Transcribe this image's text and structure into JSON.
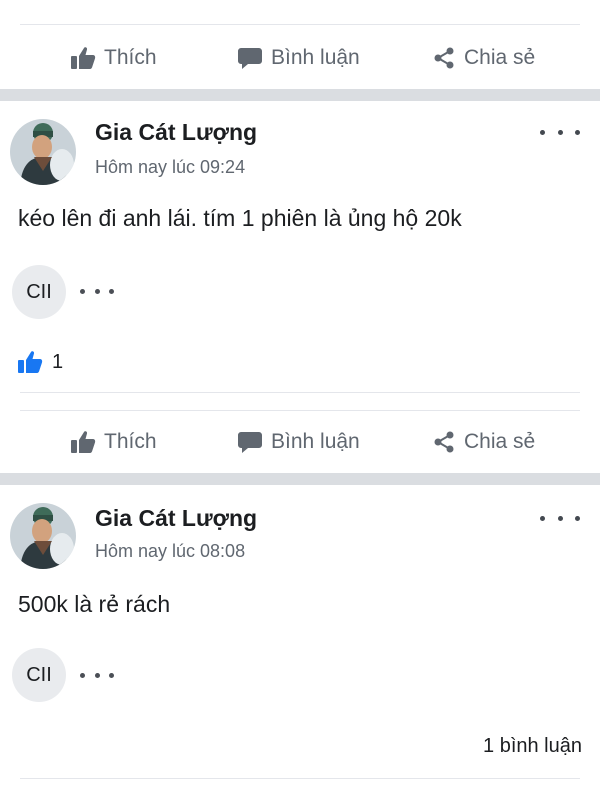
{
  "actions": {
    "like": "Thích",
    "comment": "Bình luận",
    "share": "Chia sẻ"
  },
  "posts": [
    {
      "author": "Gia Cát Lượng",
      "time": "Hôm nay lúc 09:24",
      "content": "kéo lên đi anh lái. tím 1 phiên là ủng hộ 20k",
      "chip": "CII",
      "reactions": "1"
    },
    {
      "author": "Gia Cát Lượng",
      "time": "Hôm nay lúc 08:08",
      "content": "500k là rẻ rách",
      "chip": "CII",
      "comments": "1 bình luận"
    }
  ],
  "colors": {
    "accent": "#1877f2",
    "muted_text": "#606770",
    "separator": "#dadde1"
  },
  "icons": {
    "like": "thumbs-up-icon",
    "comment": "comment-bubble-icon",
    "share": "share-icon",
    "more": "more-horizontal-icon"
  }
}
